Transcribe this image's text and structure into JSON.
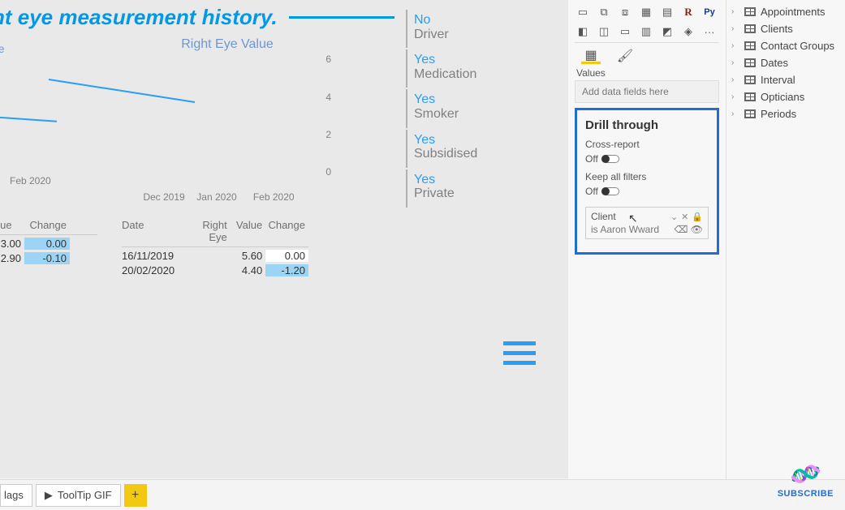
{
  "title": "nt eye measurement history.",
  "left_chart": {
    "title_stub": "ue",
    "xlabel": "Feb 2020"
  },
  "right_chart": {
    "title": "Right Eye Value",
    "x": [
      "Dec 2019",
      "Jan 2020",
      "Feb 2020"
    ],
    "y_ticks": [
      "0",
      "2",
      "4",
      "6"
    ]
  },
  "flags": [
    {
      "v": "No",
      "k": "Driver"
    },
    {
      "v": "Yes",
      "k": "Medication"
    },
    {
      "v": "Yes",
      "k": "Smoker"
    },
    {
      "v": "Yes",
      "k": "Subsidised"
    },
    {
      "v": "Yes",
      "k": "Private"
    }
  ],
  "table_left": {
    "heads": [
      "alue",
      "Change"
    ],
    "rows": [
      {
        "v": "3.00",
        "c": "0.00"
      },
      {
        "v": "2.90",
        "c": "-0.10"
      }
    ]
  },
  "table_right": {
    "heads": [
      "Date",
      "Right Eye",
      "Value",
      "Change"
    ],
    "rows": [
      {
        "d": "16/11/2019",
        "re": "",
        "v": "5.60",
        "c": "0.00"
      },
      {
        "d": "20/02/2020",
        "re": "",
        "v": "4.40",
        "c": "-1.20"
      }
    ]
  },
  "values_label": "Values",
  "values_well": "Add data fields here",
  "drill": {
    "title": "Drill through",
    "cross": "Cross-report",
    "keep": "Keep all filters",
    "off": "Off",
    "field_name": "Client",
    "field_filter": "is Aaron Wward"
  },
  "fields": [
    "Appointments",
    "Clients",
    "Contact Groups",
    "Dates",
    "Interval",
    "Opticians",
    "Periods"
  ],
  "tabs": {
    "stub": "lags",
    "tip": "ToolTip GIF"
  },
  "subscribe": "SUBSCRIBE",
  "viz_r": "R",
  "viz_py": "Py",
  "viz_more": "···",
  "chart_data": {
    "type": "line",
    "title": "Right Eye Value",
    "x": [
      "Dec 2019",
      "Jan 2020",
      "Feb 2020"
    ],
    "series": [
      {
        "name": "Right Eye Value",
        "values": [
          5.6,
          5.0,
          4.4
        ]
      }
    ],
    "ylim": [
      0,
      6
    ],
    "xlabel": "",
    "ylabel": ""
  }
}
